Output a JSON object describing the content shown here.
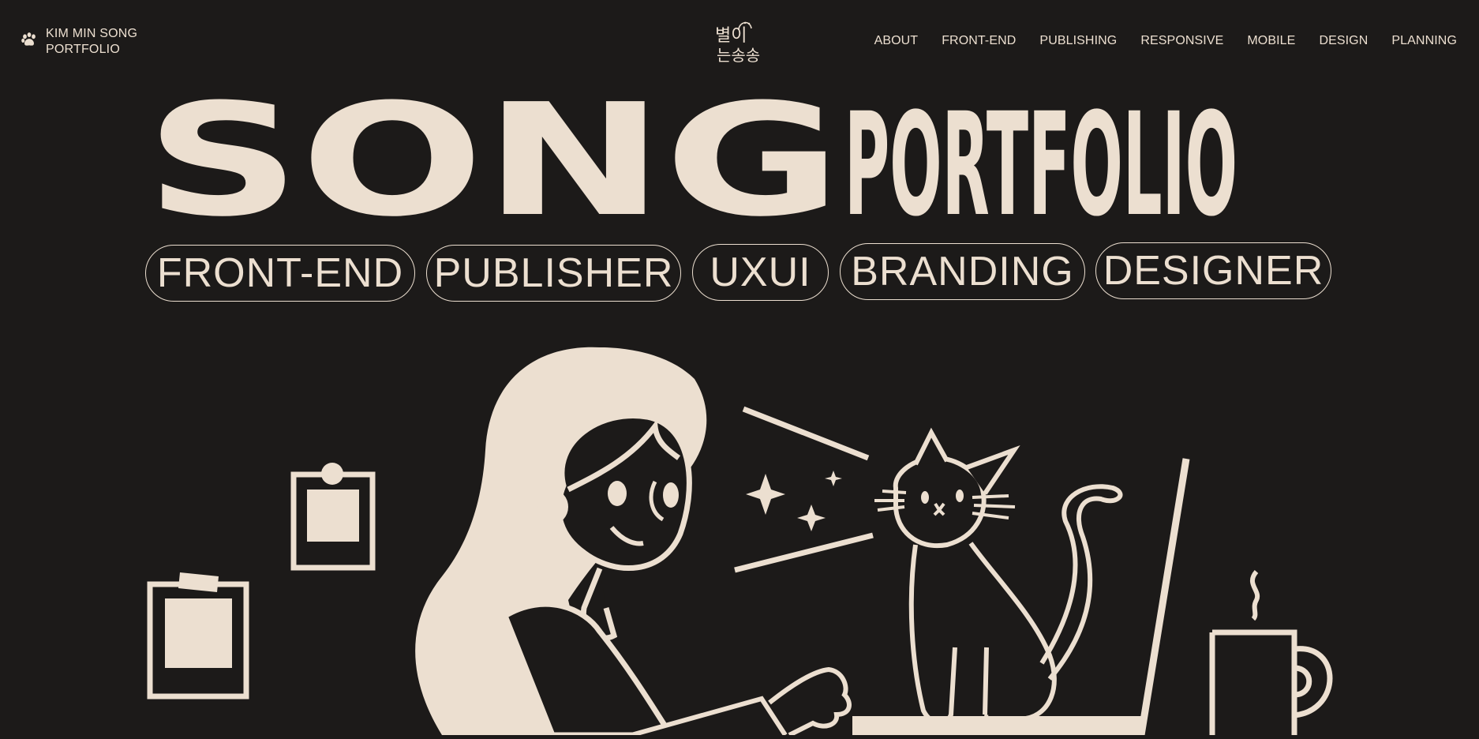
{
  "header": {
    "brand_line1": "KIM MIN SONG",
    "brand_line2": "PORTFOLIO",
    "brand_icon": "paw-icon",
    "logo_line1": "별이",
    "logo_line2": "는송송"
  },
  "nav": {
    "items": [
      "ABOUT",
      "FRONT-END",
      "PUBLISHING",
      "RESPONSIVE",
      "MOBILE",
      "DESIGN",
      "PLANNING"
    ]
  },
  "hero": {
    "title_part1": "SONG",
    "title_part2": "PORTFOLIO"
  },
  "tags": [
    "FRONT-END",
    "PUBLISHER",
    "UXUI",
    "BRANDING",
    "DESIGNER"
  ],
  "colors": {
    "background": "#1c1a19",
    "foreground": "#ecdfd0"
  }
}
